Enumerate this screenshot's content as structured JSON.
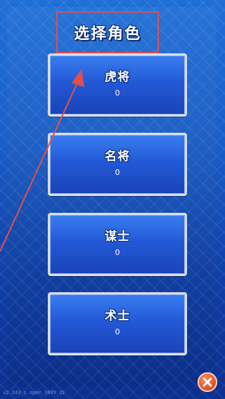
{
  "header": {
    "title": "选择角色"
  },
  "roles": [
    {
      "name": "虎将",
      "count": "0"
    },
    {
      "name": "名将",
      "count": "0"
    },
    {
      "name": "谋士",
      "count": "0"
    },
    {
      "name": "术士",
      "count": "0"
    }
  ],
  "footer": {
    "version": "v2.243_s.open_3839_d1"
  },
  "colors": {
    "background": "#1a5ec8",
    "button": "#2359d6",
    "annotation": "#e0504f",
    "close": "#e85a2c"
  },
  "icons": {
    "close": "close-icon",
    "annotation_arrow": "arrow-icon"
  }
}
